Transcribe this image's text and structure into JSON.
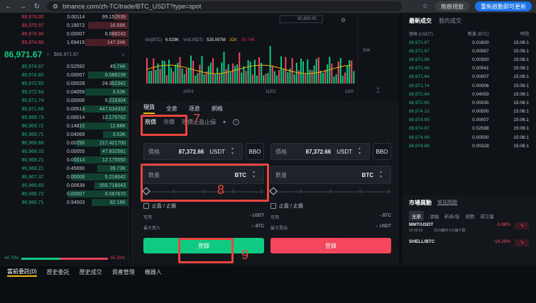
{
  "browser": {
    "url": "binance.com/zh-TC/trade/BTC_USDT?type=spot",
    "incognito_label": "無痕視窗",
    "restart_label": "重新啟動即可更新"
  },
  "orderbook": {
    "asks": [
      [
        "86,976.00",
        "0.00114",
        "99.152639"
      ],
      [
        "86,975.97",
        "0.19072",
        "16.58K"
      ],
      [
        "86,974.90",
        "0.00007",
        "6.088242"
      ],
      [
        "86,974.88",
        "1.69415",
        "147.34K"
      ]
    ],
    "mid_price": "86,971.67",
    "mid_arrow": "↑",
    "mid_fiat": "$86,971.67",
    "mid_chevron": "›",
    "bids": [
      [
        "86,974.87",
        "0.52592",
        "45.74K"
      ],
      [
        "86,974.85",
        "0.00007",
        "6.088239"
      ],
      [
        "86,972.65",
        "0.00028",
        "24.352341"
      ],
      [
        "86,972.64",
        "0.04059",
        "3.53K"
      ],
      [
        "86,971.74",
        "0.00006",
        "5.218304"
      ],
      [
        "86,971.66",
        "0.00514",
        "447.034332"
      ],
      [
        "86,969.73",
        "0.00014",
        "12.175762"
      ],
      [
        "86,969.72",
        "0.14810",
        "12.88K"
      ],
      [
        "86,969.71",
        "0.04069",
        "3.53K"
      ],
      [
        "86,968.68",
        "0.00250",
        "217.421700"
      ],
      [
        "86,968.33",
        "0.00055",
        "47.832581"
      ],
      [
        "86,968.21",
        "0.00014",
        "12.175550"
      ],
      [
        "86,968.21",
        "0.45690",
        "39.73K"
      ],
      [
        "86,967.37",
        "0.00006",
        "5.218042"
      ],
      [
        "86,966.83",
        "0.00639",
        "555.718043"
      ],
      [
        "86,966.72",
        "0.00007",
        "6.087670"
      ],
      [
        "86,966.71",
        "0.94503",
        "82.18K"
      ]
    ],
    "buy_ratio": "44.75%",
    "sell_ratio": "55.25%",
    "buy_ratio_value": 0.4475
  },
  "chart": {
    "price_label": "80,800.00",
    "vol_label": "Vol(BTC)",
    "vol_btc": "6.029K",
    "vol_usdt_label": "Vol(USDT)",
    "vol_usdt": "525.007M",
    "vol_ma1": "32K",
    "vol_ma2": "30.74K",
    "y_tick": "50K",
    "x_ticks": [
      "10/01",
      "11/01",
      "12/0"
    ]
  },
  "form": {
    "tabs": [
      "現貨",
      "全倉",
      "逐倉",
      "網格"
    ],
    "subtabs": [
      "限價",
      "市價",
      "限價止盈止損"
    ],
    "subtab_caret": "▾",
    "info_glyph": "i",
    "buy": {
      "price_label": "價格",
      "price_value": "87,372.66",
      "price_unit": "USDT",
      "bbo": "BBO",
      "qty_label": "數量",
      "qty_unit": "BTC",
      "tpsl_label": "止盈 / 止損",
      "avail_label": "可用",
      "avail_value": "- USDT",
      "max_label": "最大買入",
      "max_value": "-- BTC",
      "submit": "登錄"
    },
    "sell": {
      "price_label": "價格",
      "price_value": "87,372.66",
      "price_unit": "USDT",
      "bbo": "BBO",
      "qty_label": "數量",
      "qty_unit": "BTC",
      "tpsl_label": "止盈 / 止損",
      "avail_label": "可用",
      "avail_value": "- BTC",
      "max_label": "最大賣出",
      "max_value": "-- USDT",
      "submit": "登錄"
    }
  },
  "annotations": [
    "7",
    "8",
    "9"
  ],
  "trades": {
    "tabs": [
      "最新成交",
      "我的成交"
    ],
    "headers": [
      "價格 (USDT)",
      "數量 (BTC)",
      "時間"
    ],
    "rows": [
      [
        "86,971.67",
        "0.01800",
        "15:06:1"
      ],
      [
        "86,971.67",
        "0.00587",
        "15:06:1"
      ],
      [
        "86,971.66",
        "0.00300",
        "15:06:1"
      ],
      [
        "86,971.66",
        "0.00541",
        "15:06:1"
      ],
      [
        "86,971.64",
        "0.00007",
        "15:06:1"
      ],
      [
        "86,971.74",
        "0.00006",
        "15:06:1"
      ],
      [
        "86,972.64",
        "0.04059",
        "15:06:1"
      ],
      [
        "86,972.65",
        "0.00035",
        "15:06:1"
      ],
      [
        "86,974.10",
        "0.00500",
        "15:06:1"
      ],
      [
        "86,974.90",
        "0.00007",
        "15:06:1"
      ],
      [
        "86,974.87",
        "0.52598",
        "15:06:1"
      ],
      [
        "86,974.90",
        "0.00500",
        "15:06:1"
      ],
      [
        "86,974.88",
        "0.00328",
        "15:06:1"
      ]
    ]
  },
  "market": {
    "title": "市場異動",
    "subtitle": "常見問題",
    "tabs": [
      "全部",
      "漲幅",
      "新高/低",
      "波動",
      "成交量"
    ],
    "rows": [
      {
        "symbol": "MMT/USDT",
        "time": "15:05:02",
        "desc": "10分鐘內 5分鐘下跌",
        "change": "-3.98%",
        "arrow": "↘"
      },
      {
        "symbol": "SHELL/BTC",
        "time": "",
        "desc": "",
        "change": "-14.29%",
        "arrow": "↘"
      }
    ]
  },
  "bottom": {
    "tabs": [
      "當前委託(0)",
      "歷史委託",
      "歷史成交",
      "資產管理",
      "機器人"
    ]
  },
  "colors": {
    "buy": "#0ecb81",
    "sell": "#f6465d",
    "accent": "#f0b90b",
    "annotation": "#e9463f"
  }
}
